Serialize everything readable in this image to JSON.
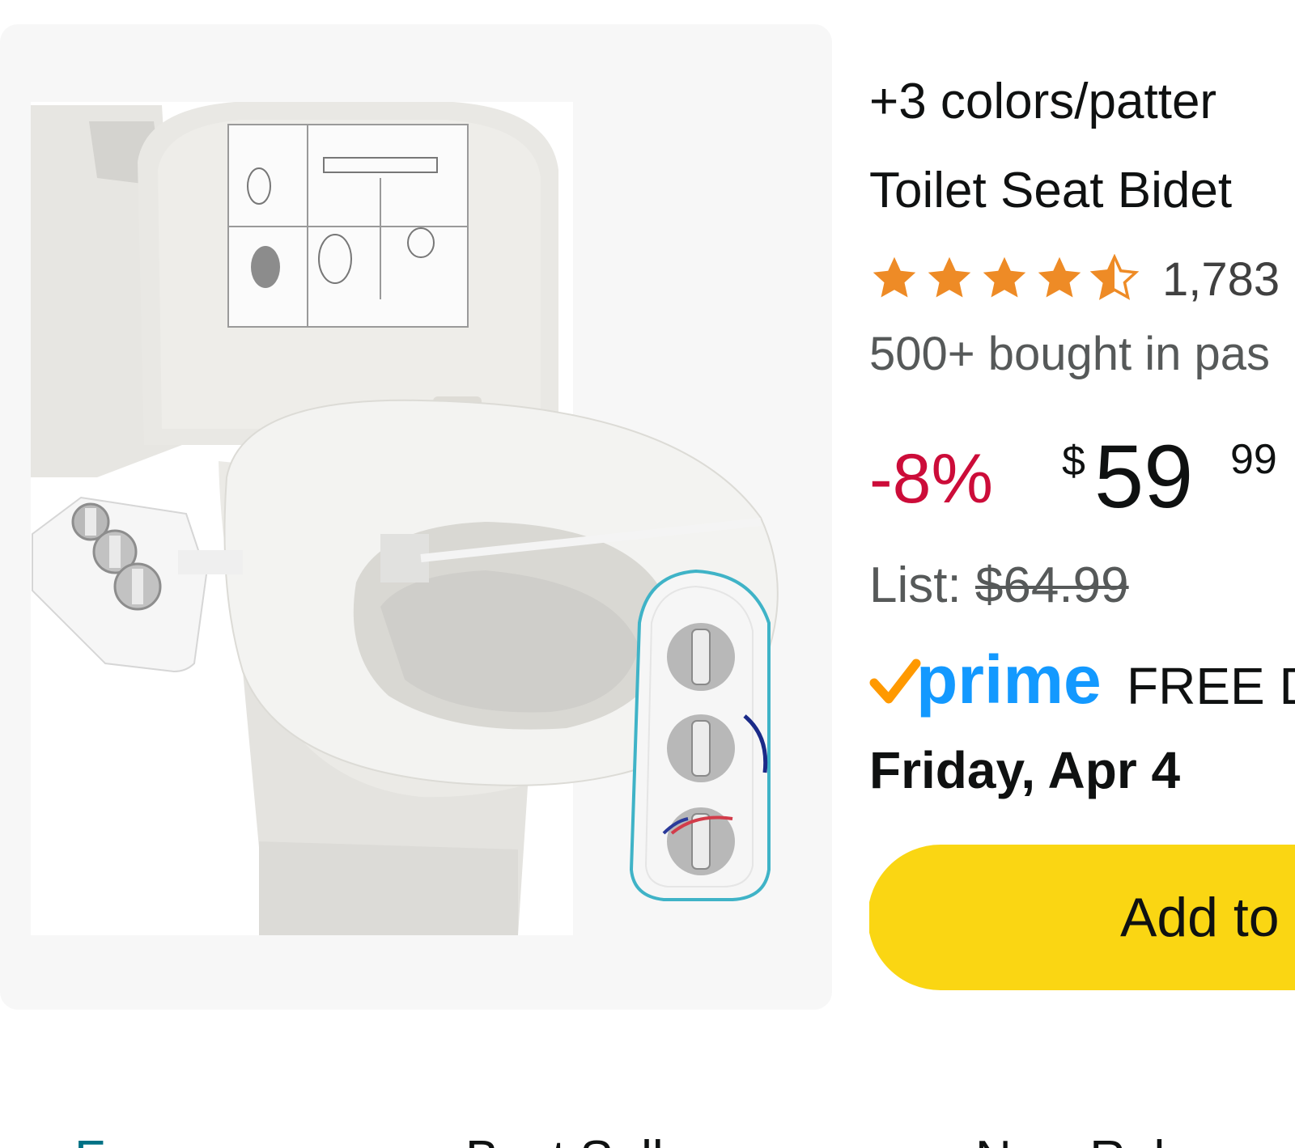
{
  "product": {
    "image_alt": "Toilet seat with attached bidet control panel",
    "variants_text": "+3 colors/patter",
    "title": "Toilet Seat Bidet",
    "rating": {
      "stars": 4.5,
      "count": "1,783"
    },
    "bought_text": "500+ bought in pas",
    "discount": "-8%",
    "price": {
      "symbol": "$",
      "whole": "59",
      "fraction": "99"
    },
    "list_label": "List:",
    "list_price": "$64.99",
    "prime_label": "prime",
    "delivery_text": "FREE D",
    "delivery_date": "Friday, Apr 4",
    "add_to_cart_label": "Add to"
  },
  "bottom_tabs": [
    {
      "label": "F"
    },
    {
      "label": "Best Sell"
    },
    {
      "label": "New Rel"
    }
  ],
  "colors": {
    "discount": "#cc0c39",
    "prime": "#1399ff",
    "check": "#ff9900",
    "star": "#ee8b26",
    "cart_button": "#fad613",
    "link": "#007185"
  }
}
